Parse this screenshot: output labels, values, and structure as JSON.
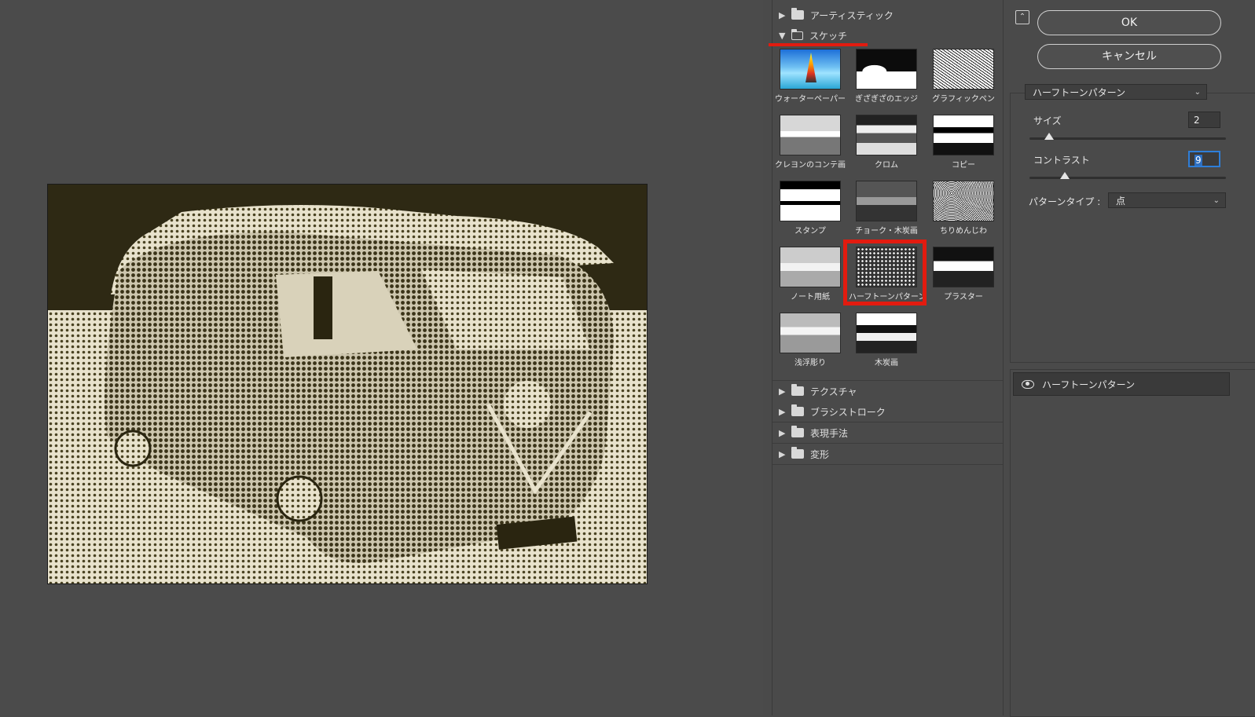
{
  "gallery": {
    "categories_top": [
      {
        "label": "アーティスティック",
        "expanded": false
      },
      {
        "label": "スケッチ",
        "expanded": true
      }
    ],
    "sketch_thumbnails": [
      {
        "label": "ウォーターペーパー",
        "style": "t-water"
      },
      {
        "label": "ぎざぎざのエッジ",
        "style": "t-bw1"
      },
      {
        "label": "グラフィックペン",
        "style": "t-graphic"
      },
      {
        "label": "クレヨンのコンテ画",
        "style": "t-crayon"
      },
      {
        "label": "クロム",
        "style": "t-chrome"
      },
      {
        "label": "コピー",
        "style": "t-copy"
      },
      {
        "label": "スタンプ",
        "style": "t-stamp"
      },
      {
        "label": "チョーク・木炭画",
        "style": "t-chalk"
      },
      {
        "label": "ちりめんじわ",
        "style": "t-reticul"
      },
      {
        "label": "ノート用紙",
        "style": "t-note"
      },
      {
        "label": "ハーフトーンパターン",
        "style": "t-halftone",
        "selected": true
      },
      {
        "label": "プラスター",
        "style": "t-plaster"
      },
      {
        "label": "浅浮彫り",
        "style": "t-relief"
      },
      {
        "label": "木炭画",
        "style": "t-charcoal"
      }
    ],
    "categories_bottom": [
      {
        "label": "テクスチャ"
      },
      {
        "label": "ブラシストローク"
      },
      {
        "label": "表現手法"
      },
      {
        "label": "変形"
      }
    ]
  },
  "settings": {
    "ok_label": "OK",
    "cancel_label": "キャンセル",
    "filter_select": "ハーフトーンパターン",
    "size_label": "サイズ",
    "size_value": "2",
    "contrast_label": "コントラスト",
    "contrast_value": "9",
    "pattern_type_label": "パターンタイプ :",
    "pattern_type_value": "点",
    "size_slider_fraction": 0.1,
    "contrast_slider_fraction": 0.18
  },
  "layers": {
    "items": [
      {
        "label": "ハーフトーンパターン",
        "visible": true
      }
    ]
  },
  "colors": {
    "highlight": "#e21b0f",
    "focus": "#2e7ed8",
    "panel_bg": "#4a4a4a"
  }
}
